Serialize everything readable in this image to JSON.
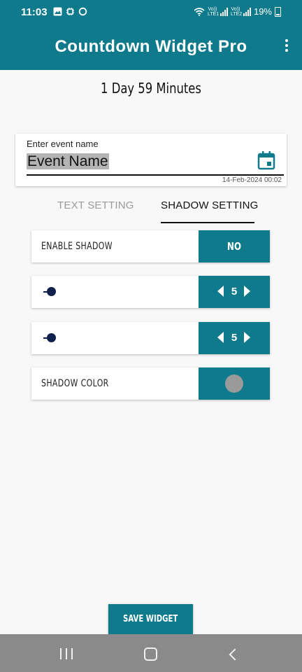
{
  "status_bar": {
    "time": "11:03",
    "sim1": "Vo)) LTE1",
    "sim2": "Vo)) LTE2",
    "battery": "19%"
  },
  "app_bar": {
    "title": "Countdown Widget Pro",
    "menu_icon": "more-vert-icon"
  },
  "countdown_text": "1 Day 59 Minutes",
  "event": {
    "label": "Enter event name",
    "name_value": "Event Name",
    "date_time": "14-Feb-2024 00:02",
    "calendar_icon": "calendar-icon"
  },
  "tabs": [
    {
      "label": "TEXT SETTING",
      "active": false
    },
    {
      "label": "SHADOW SETTING",
      "active": true
    }
  ],
  "settings": {
    "enable_shadow": {
      "label": "ENABLE SHADOW",
      "value": "NO"
    },
    "shadow_x": {
      "value": "5"
    },
    "shadow_y": {
      "value": "5"
    },
    "shadow_color": {
      "label": "SHADOW COLOR",
      "color": "#9a9a9a"
    }
  },
  "save_button": "SAVE WIDGET",
  "colors": {
    "accent": "#0e7a8c",
    "slider_dot": "#0d1f4a"
  }
}
